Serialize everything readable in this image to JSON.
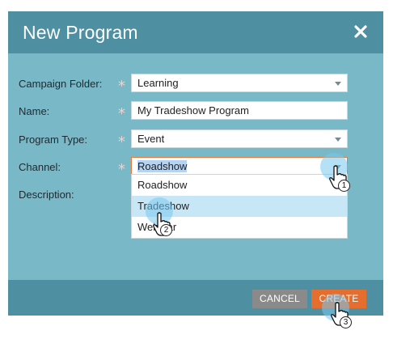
{
  "dialog": {
    "title": "New Program",
    "close_icon": "close-icon"
  },
  "form": {
    "campaign_folder": {
      "label": "Campaign Folder:",
      "value": "Learning"
    },
    "name": {
      "label": "Name:",
      "value": "My Tradeshow Program"
    },
    "program_type": {
      "label": "Program Type:",
      "value": "Event"
    },
    "channel": {
      "label": "Channel:",
      "value": "Roadshow",
      "options": [
        "Roadshow",
        "Tradeshow",
        "Webinar"
      ],
      "hovered_option": "Tradeshow"
    },
    "description": {
      "label": "Description:"
    },
    "required_mark": "*"
  },
  "footer": {
    "cancel_label": "CANCEL",
    "create_label": "CREATE"
  },
  "annotations": {
    "step1": "1",
    "step2": "2",
    "step3": "3"
  },
  "colors": {
    "header": "#4e8fa1",
    "body": "#79b8c6",
    "create_button": "#e56e2e",
    "cancel_button": "#8a8a8a",
    "hover_option": "#c7e7f6"
  }
}
